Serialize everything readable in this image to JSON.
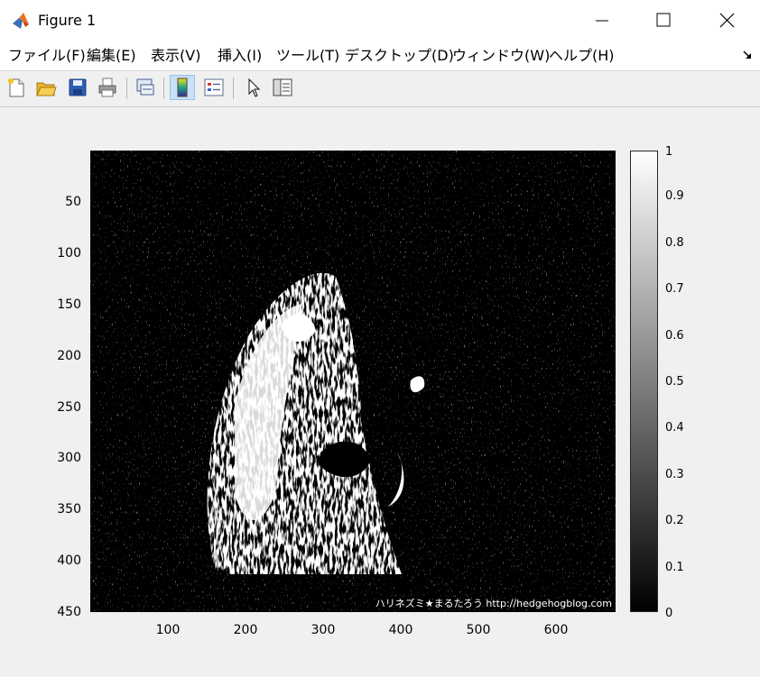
{
  "window": {
    "title": "Figure 1",
    "icon": "matlab-logo-icon",
    "controls": [
      "minimize-icon",
      "maximize-icon",
      "close-icon"
    ]
  },
  "menubar": {
    "items": [
      {
        "label": "ファイル(F)"
      },
      {
        "label": "編集(E)"
      },
      {
        "label": "表示(V)"
      },
      {
        "label": "挿入(I)"
      },
      {
        "label": "ツール(T)"
      },
      {
        "label": "デスクトップ(D)"
      },
      {
        "label": "ウィンドウ(W)"
      },
      {
        "label": "ヘルプ(H)"
      }
    ]
  },
  "toolbar": {
    "buttons": [
      "new-figure-icon",
      "open-file-icon",
      "save-icon",
      "print-icon",
      "link-plot-icon",
      "colorbar-icon",
      "legend-icon",
      "edit-plot-cursor-icon",
      "property-inspector-icon"
    ],
    "active": "colorbar-icon"
  },
  "figure": {
    "y_ticks": [
      "50",
      "100",
      "150",
      "200",
      "250",
      "300",
      "350",
      "400",
      "450"
    ],
    "x_ticks": [
      "100",
      "200",
      "300",
      "400",
      "500",
      "600"
    ],
    "colorbar_ticks": [
      "1",
      "0.9",
      "0.8",
      "0.7",
      "0.6",
      "0.5",
      "0.4",
      "0.3",
      "0.2",
      "0.1",
      "0"
    ],
    "watermark": "ハリネズミ★まるたろう http://hedgehogblog.com",
    "colors": {
      "image_background": "#000000",
      "foreground": "#ffffff"
    }
  }
}
